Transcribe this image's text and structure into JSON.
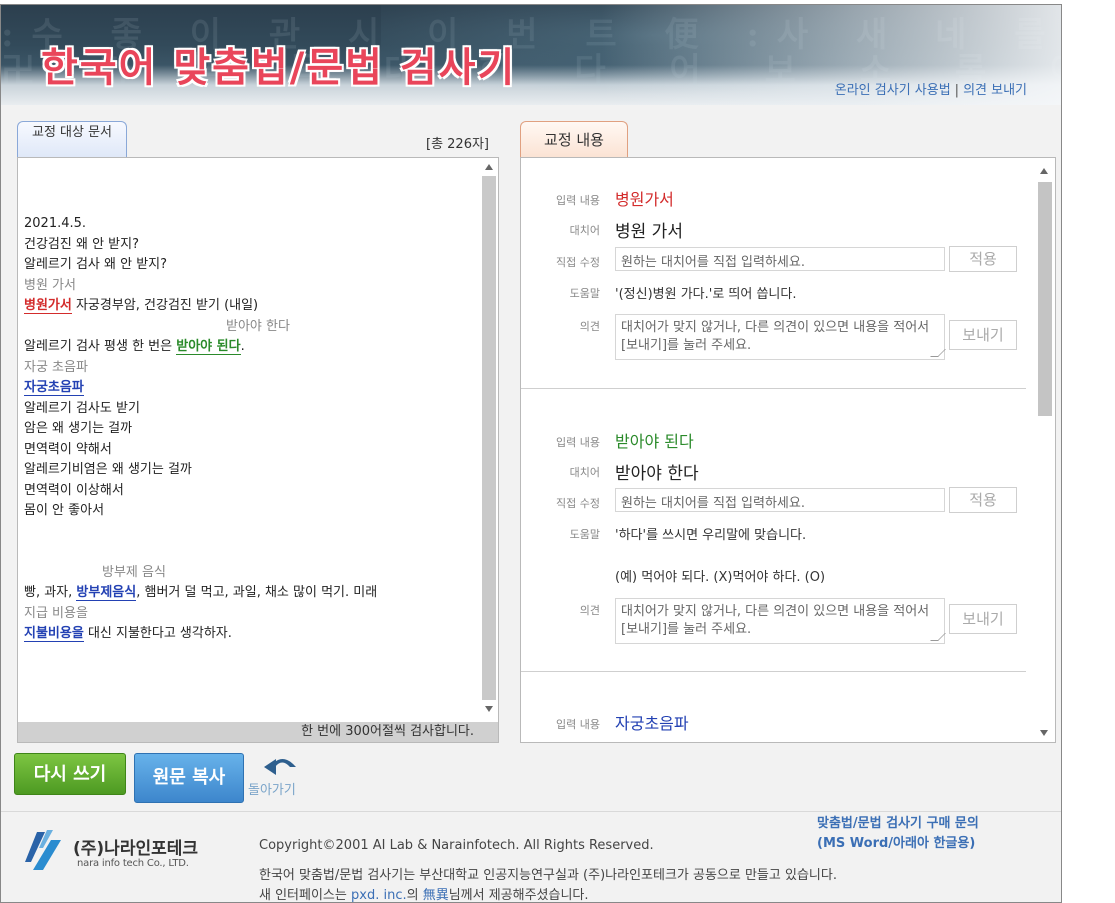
{
  "header": {
    "title": "한국어 맞춤법/문법 검사기",
    "links": {
      "usage": "온라인 검사기 사용법",
      "separator": "|",
      "feedback": "의견 보내기"
    }
  },
  "left_panel": {
    "tab_label": "교정 대상 문서",
    "char_count": "[총 226자]",
    "footer_note": "한 번에 300어절씩 검사합니다.",
    "lines": [
      "2021.4.5.",
      "건강검진 왜 안 받지?",
      "알레르기 검사 왜 안 받지?",
      "병원 가서",
      "병원가서",
      " 자궁경부암, 건강검진 받기 (내일)",
      "받아야 한다",
      "알레르기 검사 평생 한 번은 ",
      "받아야 된다",
      ".",
      "자궁 초음파",
      "자궁초음파",
      "알레르기 검사도 받기",
      "암은 왜 생기는 걸까",
      "면역력이 약해서",
      "알레르기비염은 왜 생기는 걸까",
      "면역력이 이상해서",
      "몸이 안 좋아서",
      "방부제 음식",
      "빵, 과자, ",
      "방부제음식",
      ", 햄버거 덜 먹고, 과일, 채소 많이 먹기. 미래",
      "지급 비용을",
      "지불비용을",
      " 대신 지불한다고 생각하자."
    ]
  },
  "right_panel": {
    "tab_label": "교정 내용",
    "labels": {
      "input": "입력 내용",
      "replace": "대치어",
      "direct": "직접 수정",
      "help": "도움말",
      "opinion": "의견"
    },
    "direct_placeholder": "원하는 대치어를 직접 입력하세요.",
    "opinion_placeholder": "대치어가 맞지 않거나, 다른 의견이 있으면 내용을 적어서 [보내기]를 눌러 주세요.",
    "apply_label": "적용",
    "send_label": "보내기",
    "entries": [
      {
        "input": "병원가서",
        "replacement": "병원 가서",
        "help": "'(정신)병원 가다.'로 띄어 씁니다."
      },
      {
        "input": "받아야 된다",
        "replacement": "받아야 한다",
        "help": "'하다'를 쓰시면 우리말에 맞습니다.",
        "example": "(예) 먹어야 되다. (X)먹어야 하다. (O)"
      },
      {
        "input": "자궁초음파"
      }
    ]
  },
  "buttons": {
    "rewrite": "다시 쓰기",
    "copy": "원문 복사",
    "back": "돌아가기"
  },
  "footer": {
    "logo_ko": "(주)나라인포테크",
    "logo_en": "nara info tech Co., LTD.",
    "copyright": "Copyright©2001 AI Lab & Narainfotech. All Rights Reserved.",
    "desc1": "한국어 맞춤법/문법 검사기는 부산대학교 인공지능연구실과 (주)나라인포테크가 공동으로 만들고 있습니다.",
    "desc2_a": "새 인터페이스는 ",
    "desc2_link1": "pxd. inc.",
    "desc2_b": "의 ",
    "desc2_link2": "無異",
    "desc2_c": "님께서 제공해주셨습니다.",
    "purchase1": "맞춤법/문법 검사기 구매 문의",
    "purchase2": "(MS Word/아래아 한글용)"
  },
  "colors": {
    "error_red": "#d32b2b",
    "error_green": "#2a8a2a",
    "error_blue": "#2341b3",
    "rewrite_btn": "#5aa82d",
    "copy_btn": "#4a95d8",
    "link": "#3b6fb5"
  }
}
